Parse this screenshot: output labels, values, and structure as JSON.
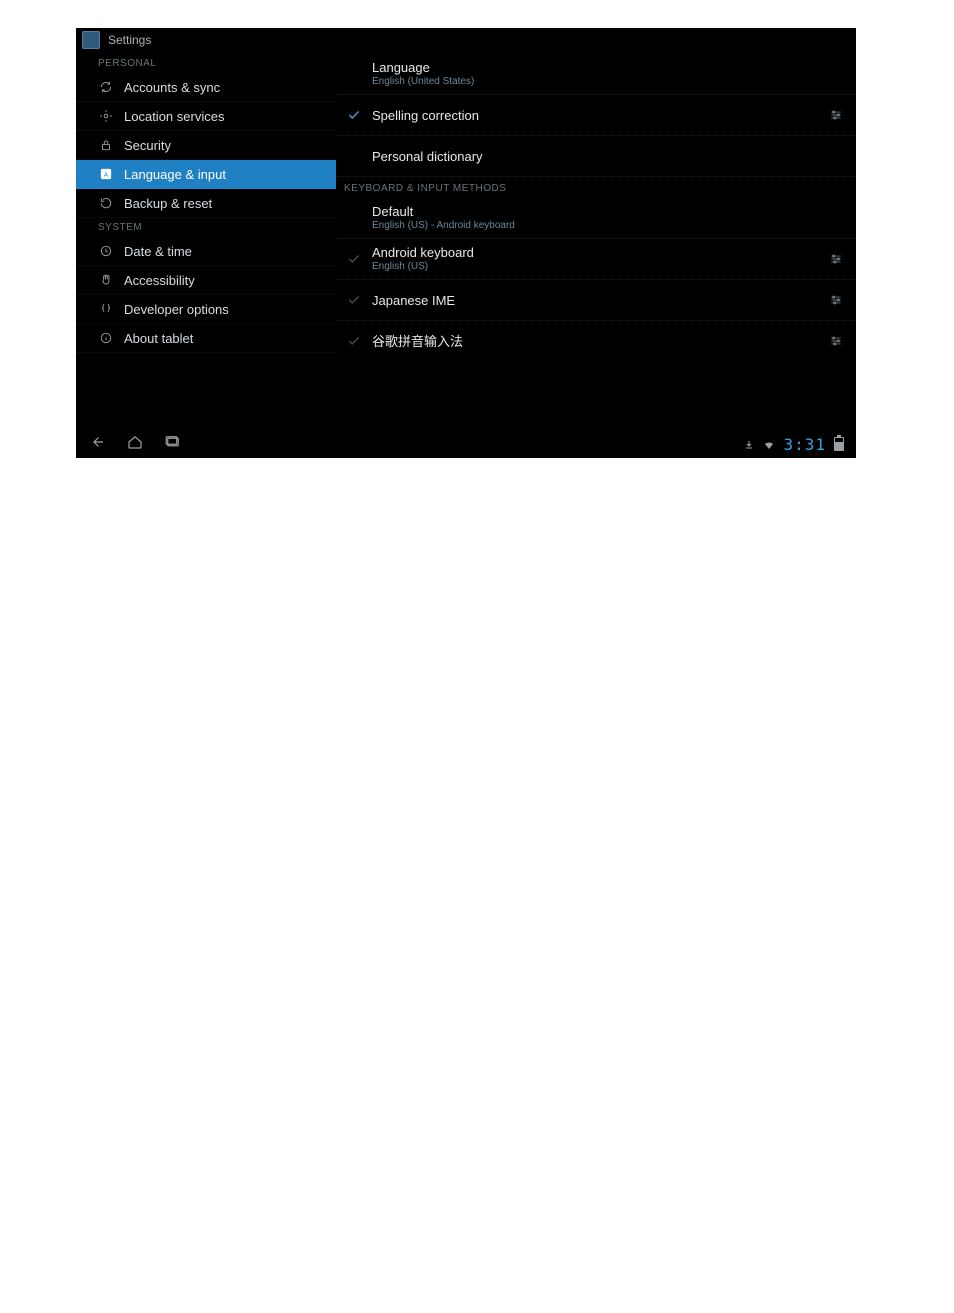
{
  "header": {
    "title": "Settings"
  },
  "sidebar": {
    "section_personal": "PERSONAL",
    "section_system": "SYSTEM",
    "items": [
      {
        "label": "Accounts & sync",
        "icon": "sync"
      },
      {
        "label": "Location services",
        "icon": "location"
      },
      {
        "label": "Security",
        "icon": "lock"
      },
      {
        "label": "Language & input",
        "icon": "lang",
        "selected": true
      },
      {
        "label": "Backup & reset",
        "icon": "backup"
      },
      {
        "label": "Date & time",
        "icon": "clock"
      },
      {
        "label": "Accessibility",
        "icon": "hand"
      },
      {
        "label": "Developer options",
        "icon": "braces"
      },
      {
        "label": "About tablet",
        "icon": "info"
      }
    ]
  },
  "content": {
    "language": {
      "title": "Language",
      "sub": "English (United States)"
    },
    "spelling": {
      "title": "Spelling correction",
      "checked": true
    },
    "dict": {
      "title": "Personal dictionary"
    },
    "section_kb": "KEYBOARD & INPUT METHODS",
    "default": {
      "title": "Default",
      "sub": "English (US) - Android keyboard"
    },
    "kb_android": {
      "title": "Android keyboard",
      "sub": "English (US)"
    },
    "kb_jp": {
      "title": "Japanese IME"
    },
    "kb_pinyin": {
      "title": "谷歌拼音输入法"
    }
  },
  "status": {
    "time": "3:31"
  }
}
